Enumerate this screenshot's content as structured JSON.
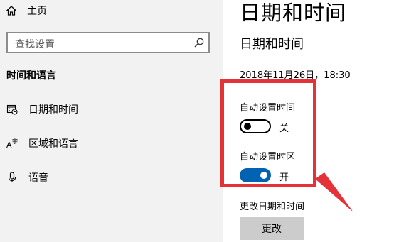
{
  "sidebar": {
    "home": {
      "label": "主页",
      "icon": "home-icon"
    },
    "search": {
      "placeholder": "查找设置",
      "icon": "search-icon"
    },
    "section_title": "时间和语言",
    "items": [
      {
        "label": "日期和时间",
        "icon": "calendar-clock-icon"
      },
      {
        "label": "区域和语言",
        "icon": "language-icon"
      },
      {
        "label": "语音",
        "icon": "microphone-icon"
      }
    ]
  },
  "main": {
    "title": "日期和时间",
    "subtitle": "日期和时间",
    "current_datetime": "2018年11月26日，18:30",
    "auto_time": {
      "label": "自动设置时间",
      "state": "关",
      "on": false
    },
    "auto_timezone": {
      "label": "自动设置时区",
      "state": "开",
      "on": true
    },
    "change_label": "更改日期和时间",
    "change_button": "更改"
  },
  "colors": {
    "accent": "#0063b1",
    "highlight": "#e53238",
    "sidebar_bg": "#f2f2f2"
  }
}
